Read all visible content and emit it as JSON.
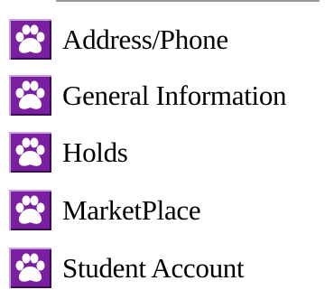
{
  "menu": {
    "items": [
      {
        "label": "Address/Phone",
        "icon": "paw-icon"
      },
      {
        "label": "General Information",
        "icon": "paw-icon"
      },
      {
        "label": "Holds",
        "icon": "paw-icon"
      },
      {
        "label": "MarketPlace",
        "icon": "paw-icon"
      },
      {
        "label": "Student Account",
        "icon": "paw-icon"
      }
    ]
  },
  "colors": {
    "icon_background": "#7a1fa0",
    "icon_paw": "#ffffff",
    "icon_border_light": "#c8a4de",
    "icon_border_dark": "#3d0a55",
    "rule": "#9a9a9a"
  }
}
